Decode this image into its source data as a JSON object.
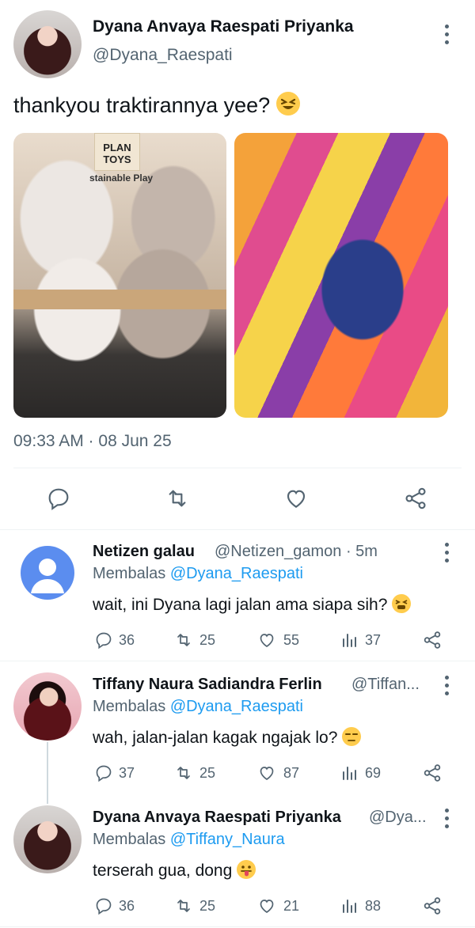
{
  "main_tweet": {
    "author_name": "Dyana Anvaya Raespati Priyanka",
    "author_handle": "@Dyana_Raespati",
    "text": "thankyou traktirannya yee?",
    "emoji": "laughing-squint-emoji",
    "image_left_sign_line1": "PLAN",
    "image_left_sign_line2": "TOYS",
    "image_left_sign_line3": "stainable Play",
    "timestamp": "09:33 AM · 08 Jun 25",
    "actions": [
      "reply",
      "retweet",
      "like",
      "share"
    ]
  },
  "replies": [
    {
      "name": "Netizen galau",
      "handle_time": "@Netizen_gamon · 5m",
      "replying_prefix": "Membalas ",
      "replying_to": "@Dyana_Raespati",
      "text": "wait, ini Dyana lagi jalan ama siapa sih?",
      "emoji": "tired-face-emoji",
      "stats": {
        "replies": "36",
        "retweets": "25",
        "likes": "55",
        "views": "37"
      }
    },
    {
      "name": "Tiffany Naura Sadiandra Ferlin",
      "handle_time": "@Tiffan...",
      "replying_prefix": "Membalas ",
      "replying_to": "@Dyana_Raespati",
      "text": "wah, jalan-jalan kagak ngajak lo?",
      "emoji": "unamused-face-emoji",
      "stats": {
        "replies": "37",
        "retweets": "25",
        "likes": "87",
        "views": "69"
      }
    },
    {
      "name": "Dyana Anvaya Raespati Priyanka",
      "handle_time": "@Dya...",
      "replying_prefix": "Membalas ",
      "replying_to": "@Tiffany_Naura",
      "text": "terserah gua, dong",
      "emoji": "tongue-out-emoji",
      "stats": {
        "replies": "36",
        "retweets": "25",
        "likes": "21",
        "views": "88"
      }
    }
  ],
  "colors": {
    "text": "#0f1419",
    "muted": "#536471",
    "link": "#1d9bf0",
    "divider": "#eff3f4"
  }
}
